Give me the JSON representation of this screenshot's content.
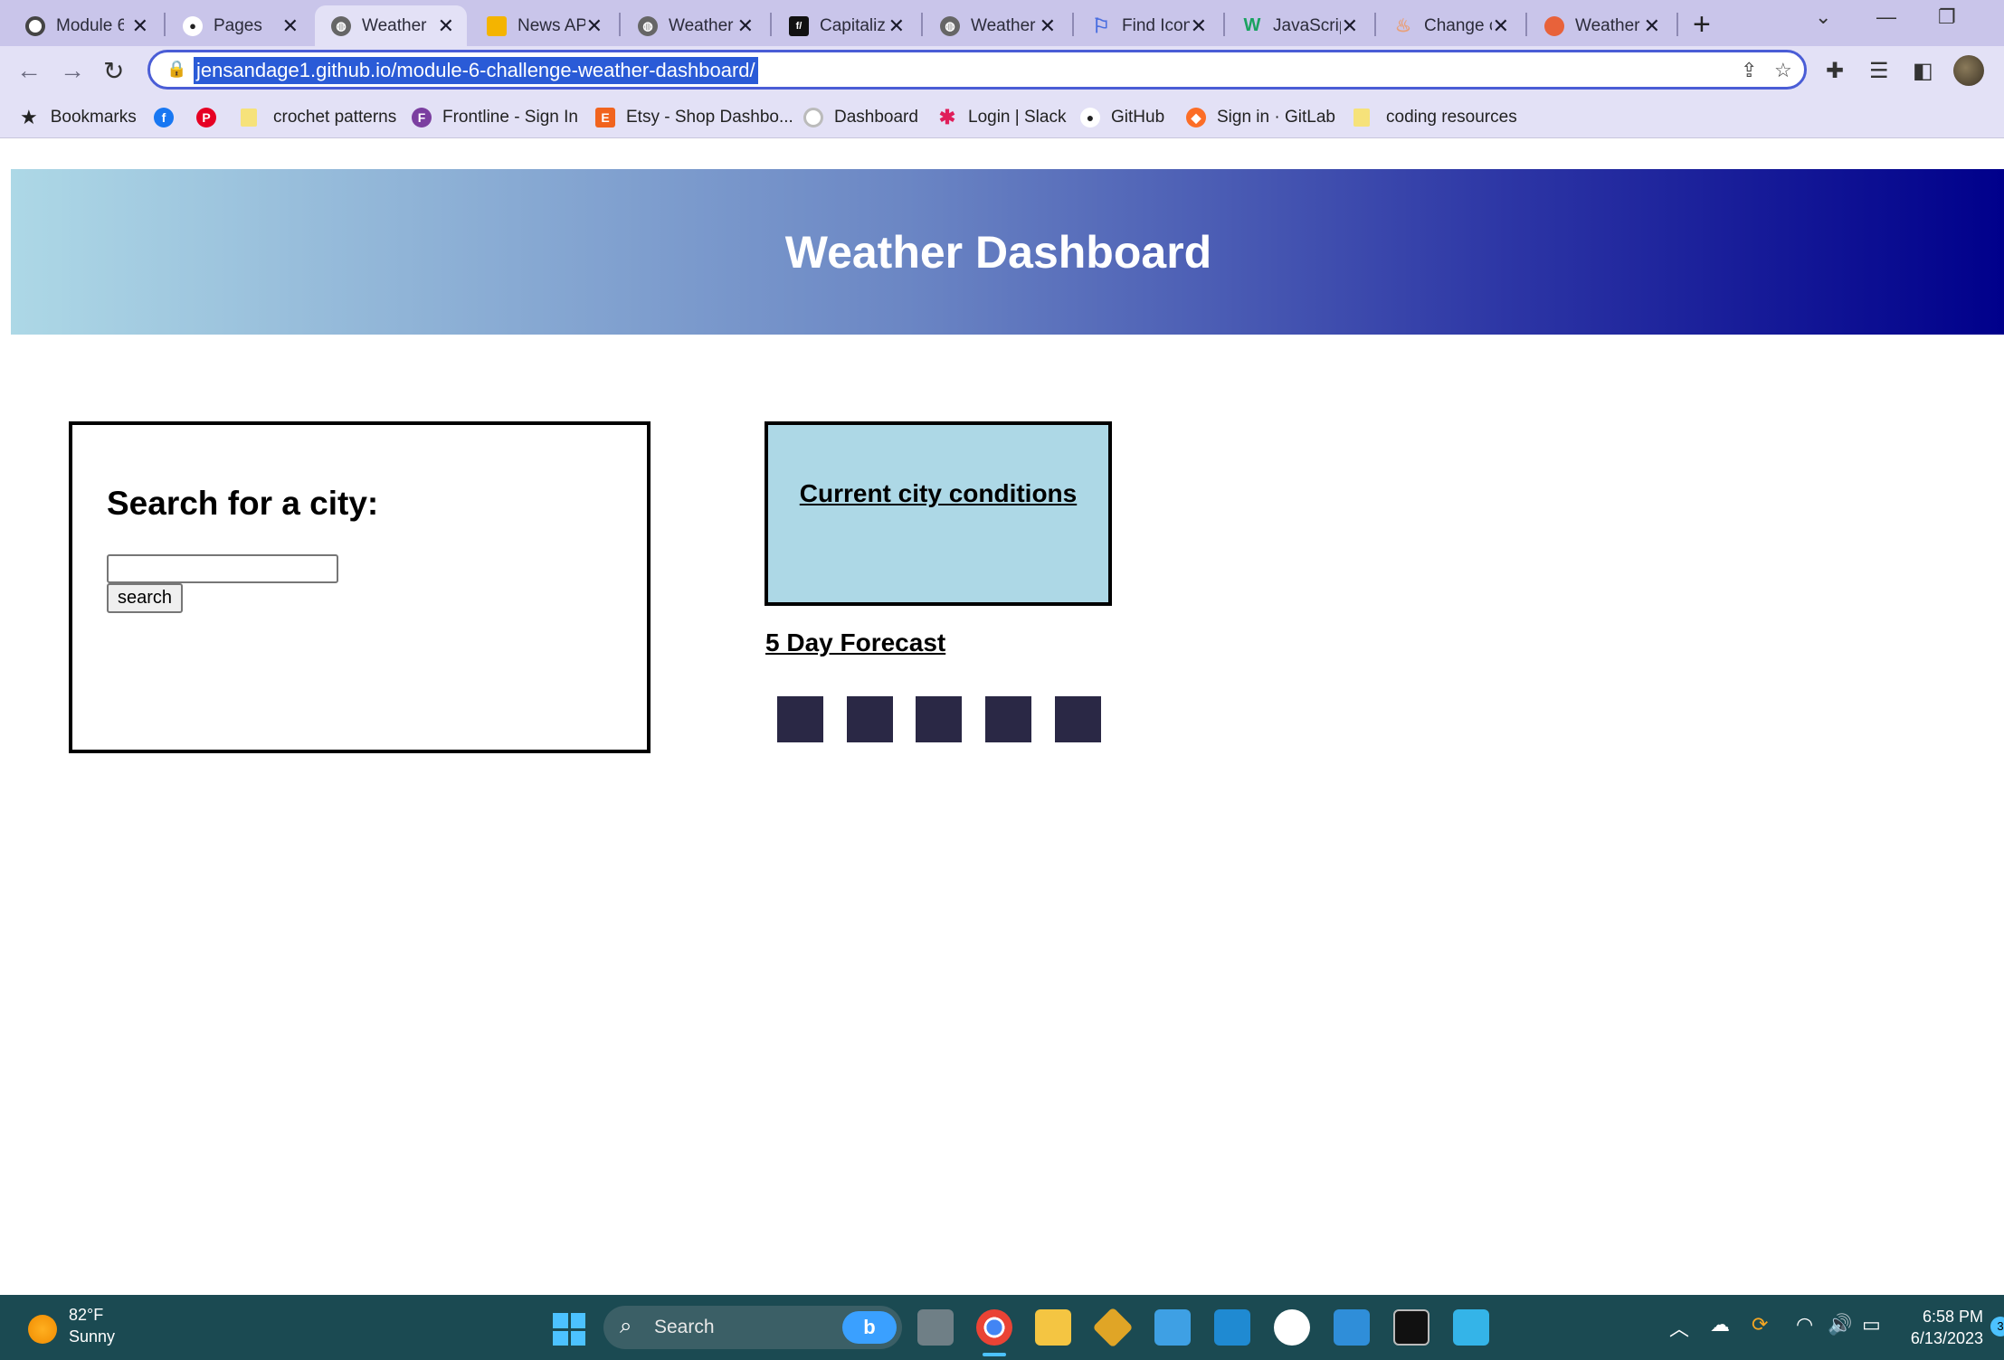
{
  "browser": {
    "tabs": [
      {
        "title": "Module 6",
        "color": "#ffffff"
      },
      {
        "title": "Pages",
        "color": "#ffffff"
      },
      {
        "title": "Weather",
        "color": "#555555"
      },
      {
        "title": "News AP",
        "color": "#f4b400"
      },
      {
        "title": "Weather",
        "color": "#555555"
      },
      {
        "title": "Capitaliz",
        "color": "#111111"
      },
      {
        "title": "Weather",
        "color": "#555555"
      },
      {
        "title": "Find Icon",
        "color": "#4a6ee0"
      },
      {
        "title": "JavaScrip",
        "color": "#1aa260"
      },
      {
        "title": "Change c",
        "color": "#e8a07a"
      },
      {
        "title": "Weather",
        "color": "#e8623a"
      }
    ],
    "url": "jensandage1.github.io/module-6-challenge-weather-dashboard/",
    "bookmarks": {
      "label": "Bookmarks",
      "items": [
        "crochet patterns",
        "Frontline - Sign In",
        "Etsy - Shop Dashbo...",
        "Dashboard",
        "Login | Slack",
        "GitHub",
        "Sign in · GitLab",
        "coding resources"
      ]
    }
  },
  "page": {
    "title": "Weather Dashboard",
    "search_heading": "Search for a city:",
    "search_input_value": "",
    "search_button": "search",
    "current_heading": "Current city conditions",
    "forecast_heading": "5 Day Forecast",
    "forecast_count": 5,
    "colors": {
      "hero_start": "#add8e6",
      "hero_end": "#00008b",
      "current_bg": "#add8e6",
      "forecast_box": "#2a2845"
    }
  },
  "taskbar": {
    "weather_temp": "82°F",
    "weather_cond": "Sunny",
    "search_label": "Search",
    "time": "6:58 PM",
    "date": "6/13/2023",
    "notification_count": "3"
  }
}
